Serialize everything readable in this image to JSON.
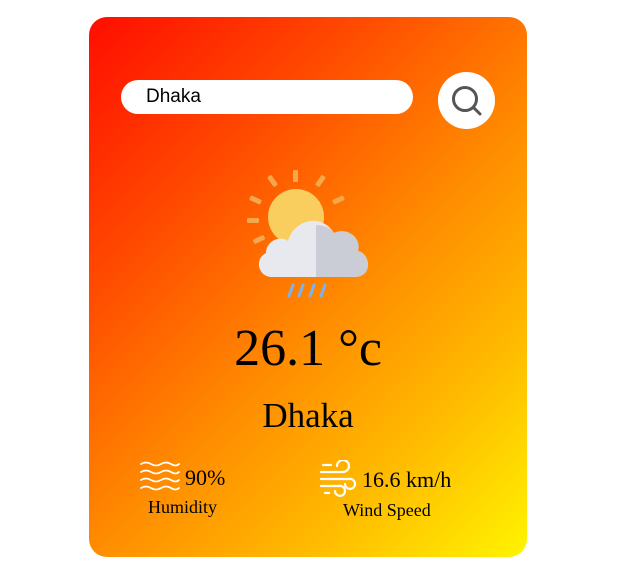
{
  "search": {
    "value": "Dhaka",
    "button_icon": "search-icon"
  },
  "weather": {
    "icon": "sun-cloud-rain-icon",
    "temperature": "26.1 °c",
    "city": "Dhaka"
  },
  "details": {
    "humidity_value": "90%",
    "humidity_label": "Humidity",
    "humidity_icon": "humidity-waves-icon",
    "wind_value": "16.6 km/h",
    "wind_label": "Wind Speed",
    "wind_icon": "wind-icon"
  },
  "colors": {
    "gradient_start": "#ff0d00",
    "gradient_end": "#fff400",
    "card_text": "#000000",
    "sun": "#f9ce5f",
    "sun_rays": "#f4a84d",
    "cloud_light": "#e7e9ee",
    "cloud_shade": "#cbcdd6",
    "rain": "#79b4f0",
    "stat_icon": "#ffffff"
  }
}
